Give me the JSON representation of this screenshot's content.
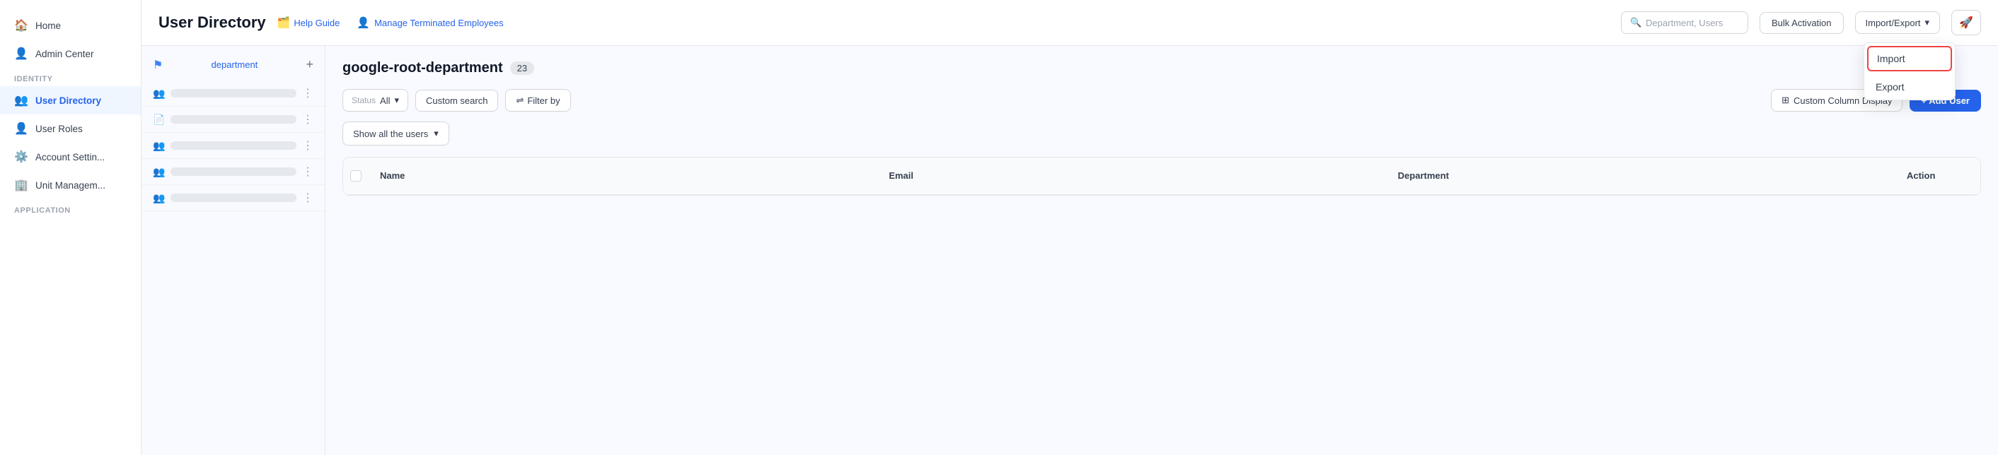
{
  "sidebar": {
    "items": [
      {
        "id": "home",
        "label": "Home",
        "icon": "🏠",
        "active": false
      },
      {
        "id": "admin-center",
        "label": "Admin Center",
        "icon": "👤",
        "active": false
      }
    ],
    "sections": [
      {
        "label": "Identity",
        "items": [
          {
            "id": "user-directory",
            "label": "User Directory",
            "icon": "👥",
            "active": true
          },
          {
            "id": "user-roles",
            "label": "User Roles",
            "icon": "👤",
            "active": false
          },
          {
            "id": "account-settings",
            "label": "Account Settin...",
            "icon": "⚙️",
            "active": false
          },
          {
            "id": "unit-management",
            "label": "Unit Managem...",
            "icon": "🏢",
            "active": false
          }
        ]
      },
      {
        "label": "Application",
        "items": []
      }
    ]
  },
  "header": {
    "title": "User Directory",
    "help_guide_label": "Help Guide",
    "manage_terminated_label": "Manage Terminated Employees",
    "search_placeholder": "Department, Users",
    "bulk_activation_label": "Bulk Activation",
    "import_export_label": "Import/Export",
    "notification_icon": "🚀"
  },
  "dropdown": {
    "items": [
      {
        "id": "import",
        "label": "Import",
        "highlighted": true
      },
      {
        "id": "export",
        "label": "Export",
        "highlighted": false
      }
    ]
  },
  "left_panel": {
    "dept_label": "department",
    "add_icon": "+"
  },
  "right_panel": {
    "dept_name": "google-root-department",
    "dept_count": "23",
    "filters": {
      "status_label": "Status",
      "status_value": "All",
      "custom_search_label": "Custom search",
      "filter_by_label": "Filter by",
      "column_display_label": "Custom Column Display",
      "add_user_label": "+ Add User"
    },
    "show_all_label": "Show all the users",
    "table": {
      "columns": [
        "",
        "Name",
        "Email",
        "Department",
        "Action"
      ]
    }
  }
}
